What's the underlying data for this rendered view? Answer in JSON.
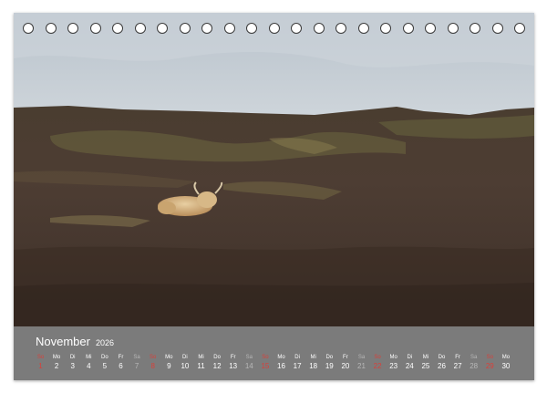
{
  "calendar": {
    "month": "November",
    "year": "2026",
    "days": [
      {
        "wd": "So",
        "dn": "1",
        "kind": "sun"
      },
      {
        "wd": "Mo",
        "dn": "2",
        "kind": "week"
      },
      {
        "wd": "Di",
        "dn": "3",
        "kind": "week"
      },
      {
        "wd": "Mi",
        "dn": "4",
        "kind": "week"
      },
      {
        "wd": "Do",
        "dn": "5",
        "kind": "week"
      },
      {
        "wd": "Fr",
        "dn": "6",
        "kind": "week"
      },
      {
        "wd": "Sa",
        "dn": "7",
        "kind": "sat"
      },
      {
        "wd": "So",
        "dn": "8",
        "kind": "sun"
      },
      {
        "wd": "Mo",
        "dn": "9",
        "kind": "week"
      },
      {
        "wd": "Di",
        "dn": "10",
        "kind": "week"
      },
      {
        "wd": "Mi",
        "dn": "11",
        "kind": "week"
      },
      {
        "wd": "Do",
        "dn": "12",
        "kind": "week"
      },
      {
        "wd": "Fr",
        "dn": "13",
        "kind": "week"
      },
      {
        "wd": "Sa",
        "dn": "14",
        "kind": "sat"
      },
      {
        "wd": "So",
        "dn": "15",
        "kind": "sun"
      },
      {
        "wd": "Mo",
        "dn": "16",
        "kind": "week"
      },
      {
        "wd": "Di",
        "dn": "17",
        "kind": "week"
      },
      {
        "wd": "Mi",
        "dn": "18",
        "kind": "week"
      },
      {
        "wd": "Do",
        "dn": "19",
        "kind": "week"
      },
      {
        "wd": "Fr",
        "dn": "20",
        "kind": "week"
      },
      {
        "wd": "Sa",
        "dn": "21",
        "kind": "sat"
      },
      {
        "wd": "So",
        "dn": "22",
        "kind": "sun"
      },
      {
        "wd": "Mo",
        "dn": "23",
        "kind": "week"
      },
      {
        "wd": "Di",
        "dn": "24",
        "kind": "week"
      },
      {
        "wd": "Mi",
        "dn": "25",
        "kind": "week"
      },
      {
        "wd": "Do",
        "dn": "26",
        "kind": "week"
      },
      {
        "wd": "Fr",
        "dn": "27",
        "kind": "week"
      },
      {
        "wd": "Sa",
        "dn": "28",
        "kind": "sat"
      },
      {
        "wd": "So",
        "dn": "29",
        "kind": "sun"
      },
      {
        "wd": "Mo",
        "dn": "30",
        "kind": "week"
      }
    ]
  },
  "colors": {
    "strip": "#7b7b7b",
    "weekday": "#ffffff",
    "saturday": "#b8b8b8",
    "sunday": "#d9403a"
  },
  "binding": {
    "ring_count": 23,
    "icon": "spiral-binding-ring-icon"
  },
  "photo": {
    "subject": "highland-cow-icon"
  }
}
